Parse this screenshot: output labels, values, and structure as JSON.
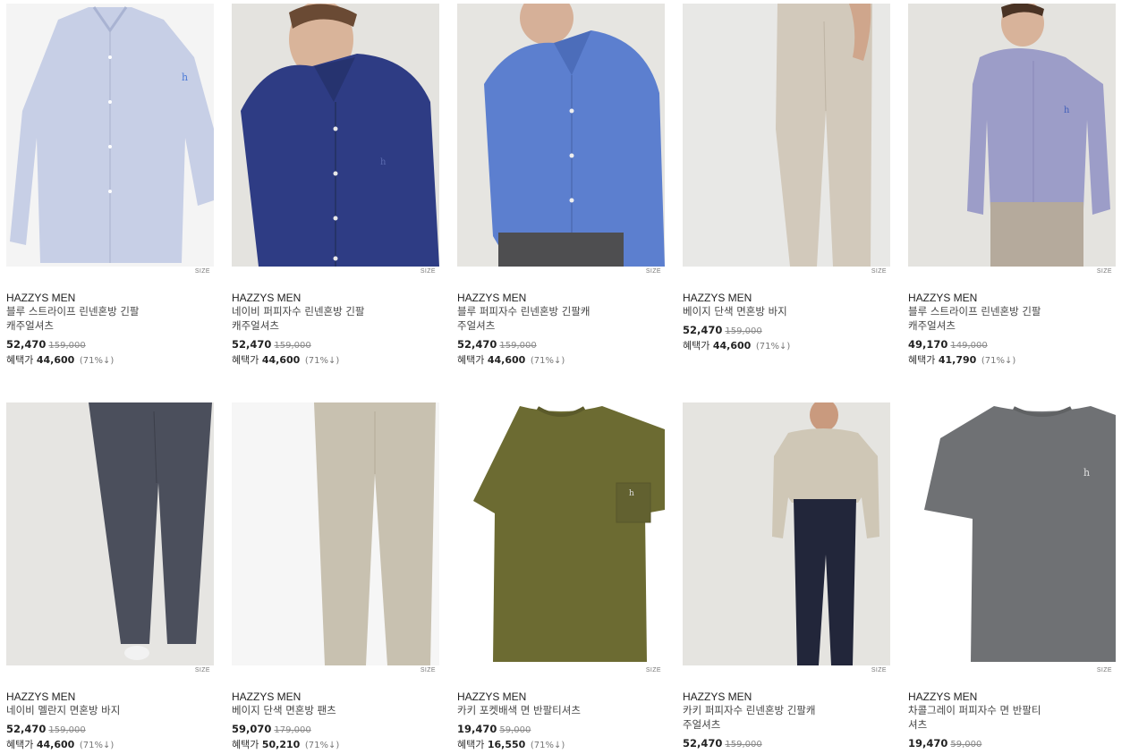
{
  "size_label": "SIZE",
  "benefit_label": "혜택가",
  "products": [
    {
      "brand": "HAZZYS MEN",
      "name_l1": "블루 스트라이프 린넨혼방 긴팔",
      "name_l2": "캐주얼셔츠",
      "price": "52,470",
      "original": "159,000",
      "benefit": "44,600",
      "rate": "(71%↓)",
      "image": "shirt-light-blue-stripe-image"
    },
    {
      "brand": "HAZZYS MEN",
      "name_l1": "네이비 퍼피자수 린넨혼방 긴팔",
      "name_l2": "캐주얼셔츠",
      "price": "52,470",
      "original": "159,000",
      "benefit": "44,600",
      "rate": "(71%↓)",
      "image": "navy-shirt-model-image"
    },
    {
      "brand": "HAZZYS MEN",
      "name_l1": "블루 퍼피자수 린넨혼방 긴팔캐",
      "name_l2": "주얼셔츠",
      "price": "52,470",
      "original": "159,000",
      "benefit": "44,600",
      "rate": "(71%↓)",
      "image": "blue-shirt-model-image"
    },
    {
      "brand": "HAZZYS MEN",
      "name_l1": "베이지 단색 면혼방 바지",
      "name_l2": "",
      "price": "52,470",
      "original": "159,000",
      "benefit": "44,600",
      "rate": "(71%↓)",
      "image": "beige-pants-model-image"
    },
    {
      "brand": "HAZZYS MEN",
      "name_l1": "블루 스트라이프 린넨혼방 긴팔",
      "name_l2": "캐주얼셔츠",
      "price": "49,170",
      "original": "149,000",
      "benefit": "41,790",
      "rate": "(71%↓)",
      "image": "blue-stripe-shirt-model-image"
    },
    {
      "brand": "HAZZYS MEN",
      "name_l1": "네이비 멜란지 면혼방 바지",
      "name_l2": "",
      "price": "52,470",
      "original": "159,000",
      "benefit": "44,600",
      "rate": "(71%↓)",
      "image": "navy-pants-model-image"
    },
    {
      "brand": "HAZZYS MEN",
      "name_l1": "베이지 단색 면혼방 팬츠",
      "name_l2": "",
      "price": "59,070",
      "original": "179,000",
      "benefit": "50,210",
      "rate": "(71%↓)",
      "image": "beige-pants-image"
    },
    {
      "brand": "HAZZYS MEN",
      "name_l1": "카키 포켓배색 면 반팔티셔츠",
      "name_l2": "",
      "price": "19,470",
      "original": "59,000",
      "benefit": "16,550",
      "rate": "(71%↓)",
      "image": "khaki-tshirt-image"
    },
    {
      "brand": "HAZZYS MEN",
      "name_l1": "카키 퍼피자수 린넨혼방 긴팔캐",
      "name_l2": "주얼셔츠",
      "price": "52,470",
      "original": "159,000",
      "benefit": "",
      "rate": "",
      "image": "khaki-shirt-model-image"
    },
    {
      "brand": "HAZZYS MEN",
      "name_l1": "차콜그레이 퍼피자수 면 반팔티",
      "name_l2": "셔츠",
      "price": "19,470",
      "original": "59,000",
      "benefit": "",
      "rate": "",
      "image": "charcoal-tshirt-image"
    }
  ]
}
